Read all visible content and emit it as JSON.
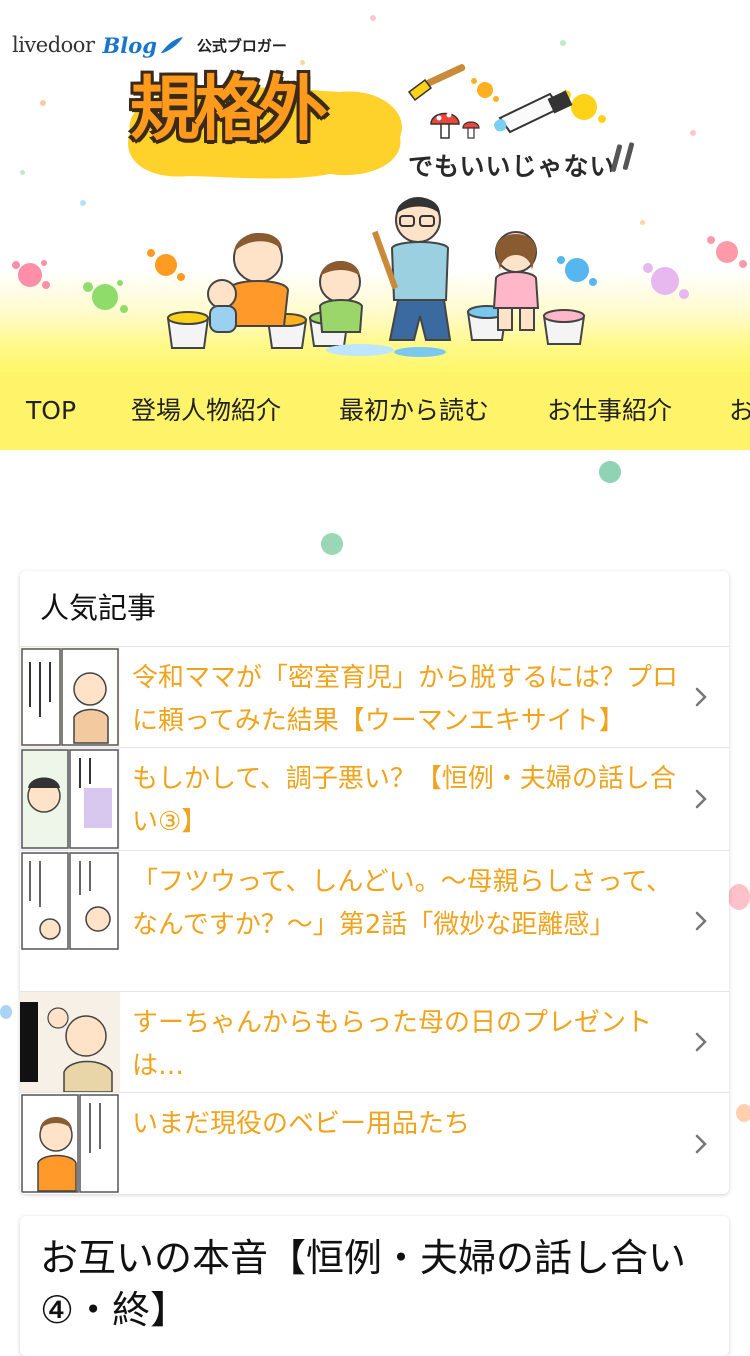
{
  "header": {
    "brand_livedoor": "livedoor",
    "brand_blog": "Blog",
    "brand_tagline": "公式ブロガー",
    "logo_title": "規格外",
    "logo_subtitle": "でもいいじゃない"
  },
  "nav": {
    "items": [
      "TOP",
      "登場人物紹介",
      "最初から読む",
      "お仕事紹介",
      "お"
    ]
  },
  "popular": {
    "heading": "人気記事",
    "articles": [
      {
        "title": "令和ママが「密室育児」から脱するには？プロに頼ってみた結果【ウーマンエキサイト】"
      },
      {
        "title": "もしかして、調子悪い？【恒例・夫婦の話し合い③】"
      },
      {
        "title": "「フツウって、しんどい。～母親らしさって、なんですか？～」第2話「微妙な距離感」"
      },
      {
        "title": "すーちゃんからもらった母の日のプレゼントは…"
      },
      {
        "title": "いまだ現役のベビー用品たち"
      }
    ]
  },
  "post": {
    "title": "お互いの本音【恒例・夫婦の話し合い④・終】"
  },
  "colors": {
    "accent_text": "#f0a31c",
    "nav_bg": "#fff36a",
    "logo_orange": "#ff9a1c"
  }
}
